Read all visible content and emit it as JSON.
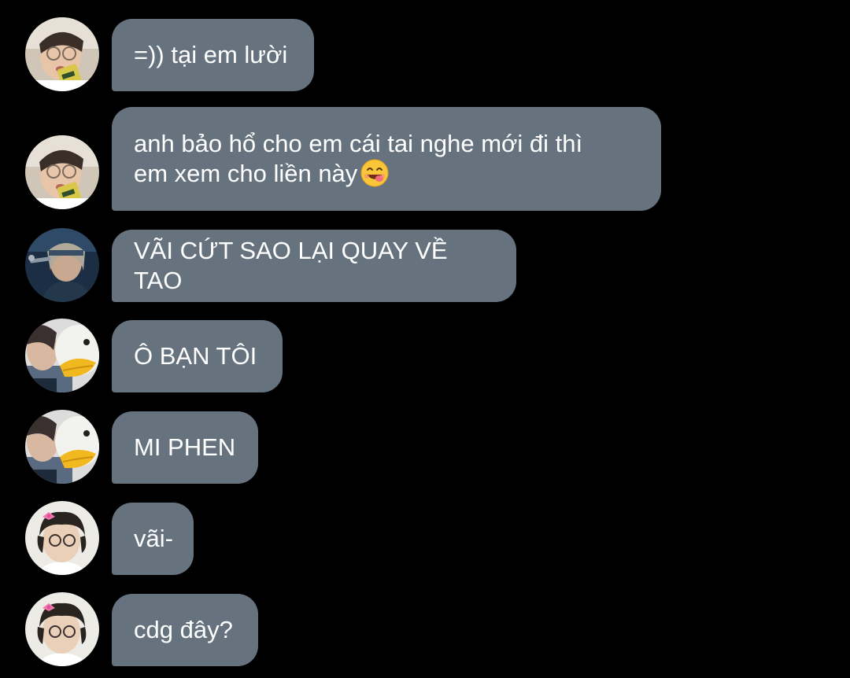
{
  "colors": {
    "background": "#000000",
    "bubble": "#66737f",
    "text": "#ffffff"
  },
  "messages": [
    {
      "avatar": "avatar-glasses-boy-icon",
      "text": "=)) tại em lười"
    },
    {
      "avatar": "avatar-glasses-boy-icon",
      "text": "anh bảo hổ cho em cái tai nghe mới đi thì\nem xem cho liền này",
      "emoji": "yum-face-emoji-icon"
    },
    {
      "avatar": "avatar-singer-headband-icon",
      "text": "VÃI CỨT SAO LẠI QUAY VỀ TAO"
    },
    {
      "avatar": "avatar-duck-plush-icon",
      "text": "Ô BẠN TÔI"
    },
    {
      "avatar": "avatar-duck-plush-icon",
      "text": "MI PHEN"
    },
    {
      "avatar": "avatar-bow-boy-icon",
      "text": "vãi-"
    },
    {
      "avatar": "avatar-bow-boy-icon",
      "text": "cdg đây?"
    }
  ]
}
